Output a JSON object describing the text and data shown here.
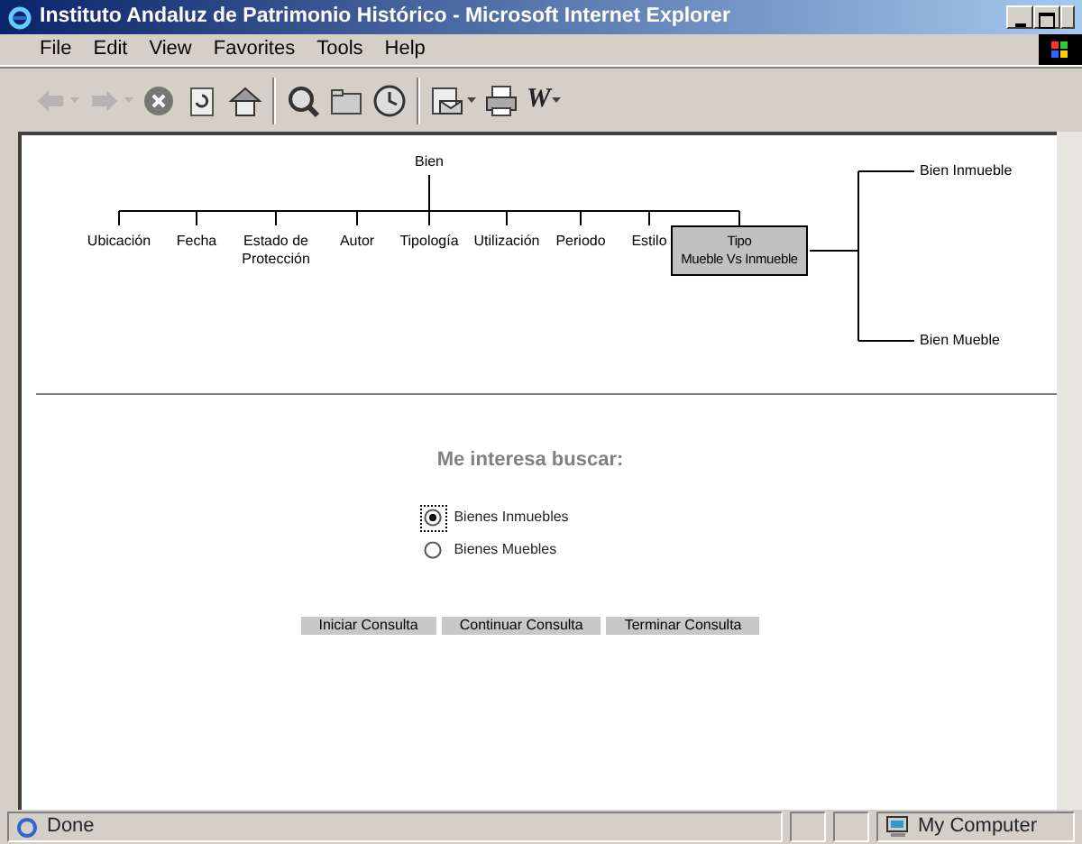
{
  "window": {
    "title": "Instituto Andaluz de Patrimonio Histórico - Microsoft Internet Explorer"
  },
  "menu": [
    "File",
    "Edit",
    "View",
    "Favorites",
    "Tools",
    "Help"
  ],
  "toolbar": [
    {
      "kind": "back",
      "disabled": true,
      "dropdown": true
    },
    {
      "kind": "forward",
      "disabled": true,
      "dropdown": true
    },
    {
      "kind": "stop",
      "disabled": false,
      "dropdown": false
    },
    {
      "kind": "refresh",
      "disabled": false,
      "dropdown": false
    },
    {
      "kind": "home",
      "disabled": false,
      "dropdown": false
    },
    {
      "kind": "sep"
    },
    {
      "kind": "search",
      "disabled": false,
      "dropdown": false
    },
    {
      "kind": "favorites",
      "disabled": false,
      "dropdown": false
    },
    {
      "kind": "history",
      "disabled": false,
      "dropdown": false
    },
    {
      "kind": "sep"
    },
    {
      "kind": "mail",
      "disabled": false,
      "dropdown": true
    },
    {
      "kind": "print",
      "disabled": false,
      "dropdown": false
    },
    {
      "kind": "text",
      "label": "W",
      "disabled": false,
      "dropdown": true
    }
  ],
  "tree": {
    "root": "Bien",
    "children": [
      {
        "label": "Ubicación",
        "selected": false
      },
      {
        "label": "Fecha",
        "selected": false
      },
      {
        "label": "Estado de\nProtección",
        "selected": false
      },
      {
        "label": "Autor",
        "selected": false
      },
      {
        "label": "Tipología",
        "selected": false
      },
      {
        "label": "Utilización",
        "selected": false
      },
      {
        "label": "Periodo",
        "selected": false
      },
      {
        "label": "Estilo",
        "selected": false
      },
      {
        "label": "Tipo\nMueble Vs Inmueble",
        "selected": true,
        "children": [
          {
            "label": "Bien Inmueble"
          },
          {
            "label": "Bien Mueble"
          }
        ]
      }
    ]
  },
  "form": {
    "heading": "Me interesa buscar:",
    "options": [
      {
        "label": "Bienes Inmuebles",
        "selected": true
      },
      {
        "label": "Bienes Muebles",
        "selected": false
      }
    ],
    "buttons": [
      "Iniciar Consulta",
      "Continuar Consulta",
      "Terminar Consulta"
    ]
  },
  "status_bar": {
    "text": "Done",
    "zone": "My Computer"
  }
}
